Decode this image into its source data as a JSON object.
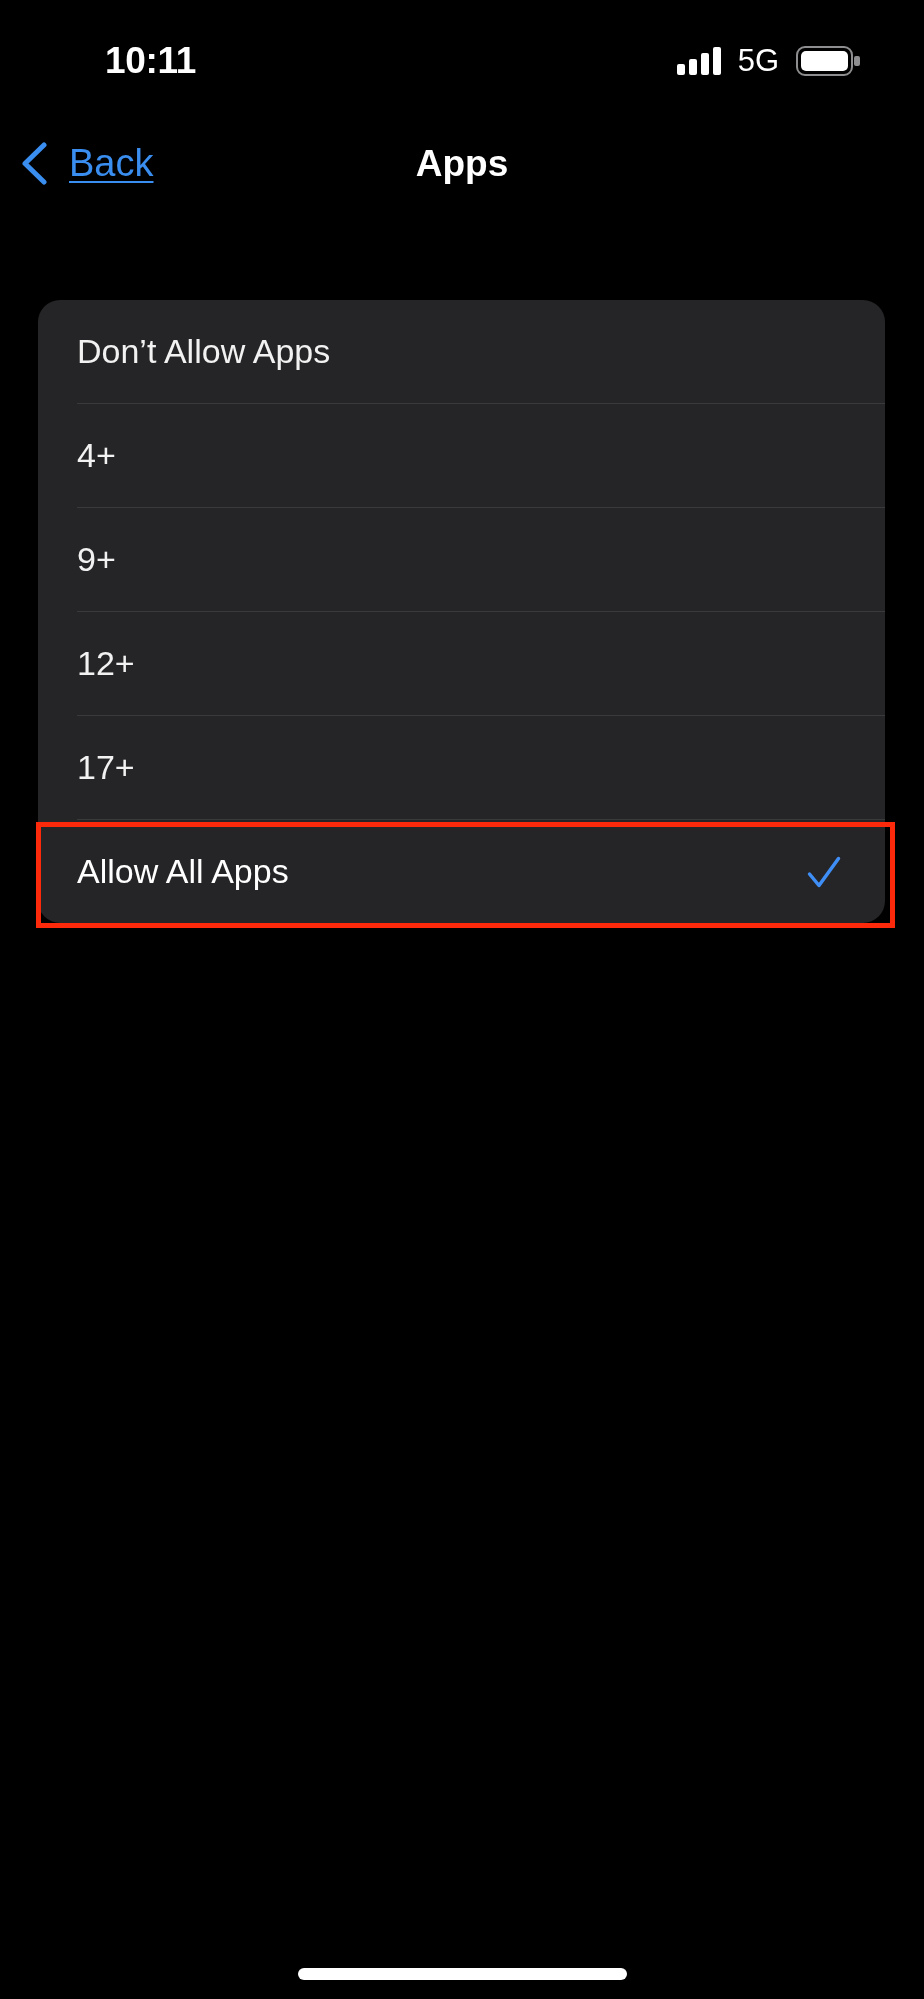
{
  "status_bar": {
    "time": "10:11",
    "network": "5G"
  },
  "nav_bar": {
    "back_button": "Back",
    "title": "Apps"
  },
  "options": [
    {
      "label": "Don’t Allow Apps",
      "selected": false,
      "highlighted": false
    },
    {
      "label": "4+",
      "selected": false,
      "highlighted": false
    },
    {
      "label": "9+",
      "selected": false,
      "highlighted": false
    },
    {
      "label": "12+",
      "selected": false,
      "highlighted": false
    },
    {
      "label": "17+",
      "selected": false,
      "highlighted": false
    },
    {
      "label": "Allow All Apps",
      "selected": true,
      "highlighted": true
    }
  ]
}
